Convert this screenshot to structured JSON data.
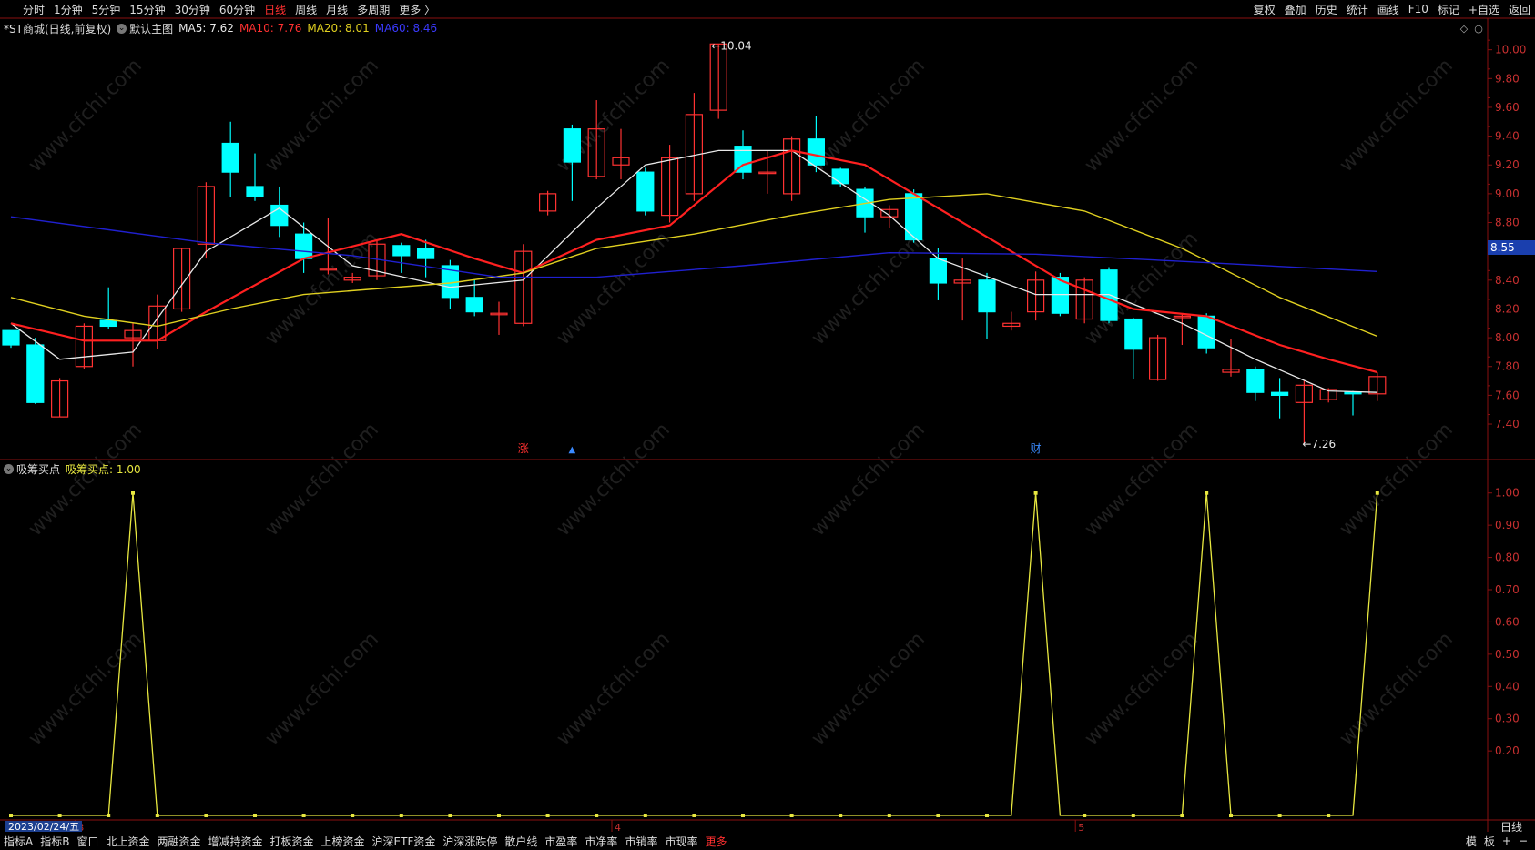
{
  "topbar": {
    "timeframes": [
      "分时",
      "1分钟",
      "5分钟",
      "15分钟",
      "30分钟",
      "60分钟",
      "日线",
      "周线",
      "月线",
      "多周期",
      "更多 〉"
    ],
    "active_index": 6,
    "tools": [
      "复权",
      "叠加",
      "历史",
      "统计",
      "画线",
      "F10",
      "标记",
      "+自选",
      "返回"
    ]
  },
  "main_header": {
    "stock": "*ST商城(日线,前复权)",
    "template": "默认主图",
    "ma5": "MA5: 7.62",
    "ma10": "MA10: 7.76",
    "ma20": "MA20: 8.01",
    "ma60": "MA60: 8.46"
  },
  "indicator_header": {
    "name": "吸筹买点",
    "value": "吸筹买点: 1.00"
  },
  "colors": {
    "up": "#ff3232",
    "down": "#00ffff",
    "ma5": "#e8e8e8",
    "ma10": "#ff2020",
    "ma20": "#e0d020",
    "ma60": "#2020d0",
    "indicator": "#e8e840",
    "axis": "#8a1010"
  },
  "chart_data": [
    {
      "type": "candlestick",
      "title": "*ST商城(日线,前复权)",
      "y_ticks": [
        10.0,
        9.8,
        9.6,
        9.4,
        9.2,
        9.0,
        8.8,
        8.6,
        8.4,
        8.2,
        8.0,
        7.8,
        7.6,
        7.4
      ],
      "ylim": [
        7.16,
        10.08
      ],
      "last_price": "8.55",
      "high_label": "10.04",
      "low_label": "7.26",
      "markers": [
        "涨",
        "▲",
        "财"
      ],
      "candles": [
        {
          "o": 8.05,
          "c": 7.95,
          "h": 8.05,
          "l": 7.93
        },
        {
          "o": 7.95,
          "c": 7.55,
          "h": 8.0,
          "l": 7.54
        },
        {
          "o": 7.45,
          "c": 7.7,
          "h": 7.72,
          "l": 7.45
        },
        {
          "o": 7.8,
          "c": 8.08,
          "h": 8.1,
          "l": 7.78
        },
        {
          "o": 8.12,
          "c": 8.08,
          "h": 8.35,
          "l": 8.06
        },
        {
          "o": 8.0,
          "c": 8.05,
          "h": 8.1,
          "l": 7.8
        },
        {
          "o": 7.98,
          "c": 8.22,
          "h": 8.3,
          "l": 7.92
        },
        {
          "o": 8.2,
          "c": 8.62,
          "h": 8.62,
          "l": 8.18
        },
        {
          "o": 8.65,
          "c": 9.05,
          "h": 9.08,
          "l": 8.55
        },
        {
          "o": 9.35,
          "c": 9.15,
          "h": 9.5,
          "l": 8.98
        },
        {
          "o": 9.05,
          "c": 8.98,
          "h": 9.28,
          "l": 8.95
        },
        {
          "o": 8.92,
          "c": 8.78,
          "h": 9.05,
          "l": 8.7
        },
        {
          "o": 8.72,
          "c": 8.55,
          "h": 8.8,
          "l": 8.45
        },
        {
          "o": 8.47,
          "c": 8.48,
          "h": 8.83,
          "l": 8.44
        },
        {
          "o": 8.4,
          "c": 8.42,
          "h": 8.45,
          "l": 8.38
        },
        {
          "o": 8.43,
          "c": 8.65,
          "h": 8.68,
          "l": 8.4
        },
        {
          "o": 8.64,
          "c": 8.57,
          "h": 8.66,
          "l": 8.45
        },
        {
          "o": 8.62,
          "c": 8.55,
          "h": 8.68,
          "l": 8.42
        },
        {
          "o": 8.5,
          "c": 8.28,
          "h": 8.54,
          "l": 8.2
        },
        {
          "o": 8.28,
          "c": 8.18,
          "h": 8.4,
          "l": 8.15
        },
        {
          "o": 8.16,
          "c": 8.17,
          "h": 8.25,
          "l": 8.02
        },
        {
          "o": 8.1,
          "c": 8.6,
          "h": 8.65,
          "l": 8.08
        },
        {
          "o": 8.88,
          "c": 9.0,
          "h": 9.02,
          "l": 8.85
        },
        {
          "o": 9.45,
          "c": 9.22,
          "h": 9.48,
          "l": 8.95
        },
        {
          "o": 9.12,
          "c": 9.45,
          "h": 9.65,
          "l": 9.1
        },
        {
          "o": 9.2,
          "c": 9.25,
          "h": 9.45,
          "l": 9.1
        },
        {
          "o": 9.15,
          "c": 8.88,
          "h": 9.18,
          "l": 8.85
        },
        {
          "o": 8.85,
          "c": 9.25,
          "h": 9.34,
          "l": 8.8
        },
        {
          "o": 9.0,
          "c": 9.55,
          "h": 9.7,
          "l": 8.95
        },
        {
          "o": 9.58,
          "c": 10.04,
          "h": 10.04,
          "l": 9.52
        },
        {
          "o": 9.33,
          "c": 9.15,
          "h": 9.44,
          "l": 9.1
        },
        {
          "o": 9.15,
          "c": 9.15,
          "h": 9.3,
          "l": 9.0
        },
        {
          "o": 9.0,
          "c": 9.38,
          "h": 9.4,
          "l": 8.95
        },
        {
          "o": 9.38,
          "c": 9.2,
          "h": 9.54,
          "l": 9.15
        },
        {
          "o": 9.17,
          "c": 9.07,
          "h": 9.18,
          "l": 9.05
        },
        {
          "o": 9.03,
          "c": 8.84,
          "h": 9.05,
          "l": 8.73
        },
        {
          "o": 8.84,
          "c": 8.89,
          "h": 8.92,
          "l": 8.76
        },
        {
          "o": 9.0,
          "c": 8.68,
          "h": 9.03,
          "l": 8.66
        },
        {
          "o": 8.55,
          "c": 8.38,
          "h": 8.62,
          "l": 8.26
        },
        {
          "o": 8.38,
          "c": 8.4,
          "h": 8.55,
          "l": 8.12
        },
        {
          "o": 8.4,
          "c": 8.18,
          "h": 8.45,
          "l": 7.99
        },
        {
          "o": 8.08,
          "c": 8.1,
          "h": 8.18,
          "l": 8.05
        },
        {
          "o": 8.18,
          "c": 8.4,
          "h": 8.46,
          "l": 8.12
        },
        {
          "o": 8.42,
          "c": 8.17,
          "h": 8.45,
          "l": 8.15
        },
        {
          "o": 8.13,
          "c": 8.4,
          "h": 8.42,
          "l": 8.1
        },
        {
          "o": 8.47,
          "c": 8.12,
          "h": 8.49,
          "l": 8.1
        },
        {
          "o": 8.13,
          "c": 7.92,
          "h": 8.14,
          "l": 7.71
        },
        {
          "o": 7.71,
          "c": 8.0,
          "h": 8.02,
          "l": 7.7
        },
        {
          "o": 8.14,
          "c": 8.15,
          "h": 8.17,
          "l": 7.95
        },
        {
          "o": 8.15,
          "c": 7.93,
          "h": 8.17,
          "l": 7.89
        },
        {
          "o": 7.76,
          "c": 7.78,
          "h": 7.99,
          "l": 7.73
        },
        {
          "o": 7.78,
          "c": 7.62,
          "h": 7.8,
          "l": 7.56
        },
        {
          "o": 7.62,
          "c": 7.6,
          "h": 7.72,
          "l": 7.44
        },
        {
          "o": 7.55,
          "c": 7.67,
          "h": 7.7,
          "l": 7.26
        },
        {
          "o": 7.57,
          "c": 7.64,
          "h": 7.65,
          "l": 7.55
        },
        {
          "o": 7.62,
          "c": 7.61,
          "h": 7.63,
          "l": 7.46
        },
        {
          "o": 7.61,
          "c": 7.73,
          "h": 7.76,
          "l": 7.56
        }
      ],
      "ma_series": [
        {
          "name": "MA5",
          "points": [
            [
              0,
              8.1
            ],
            [
              2,
              7.85
            ],
            [
              5,
              7.9
            ],
            [
              8,
              8.6
            ],
            [
              11,
              8.9
            ],
            [
              14,
              8.5
            ],
            [
              18,
              8.35
            ],
            [
              21,
              8.4
            ],
            [
              24,
              8.9
            ],
            [
              26,
              9.2
            ],
            [
              29,
              9.3
            ],
            [
              32,
              9.3
            ],
            [
              36,
              8.85
            ],
            [
              38,
              8.55
            ],
            [
              42,
              8.3
            ],
            [
              45,
              8.3
            ],
            [
              48,
              8.1
            ],
            [
              51,
              7.85
            ],
            [
              54,
              7.63
            ],
            [
              56,
              7.62
            ]
          ]
        },
        {
          "name": "MA10",
          "points": [
            [
              0,
              8.1
            ],
            [
              3,
              7.98
            ],
            [
              6,
              7.98
            ],
            [
              8,
              8.18
            ],
            [
              12,
              8.55
            ],
            [
              16,
              8.72
            ],
            [
              19,
              8.55
            ],
            [
              21,
              8.45
            ],
            [
              24,
              8.68
            ],
            [
              27,
              8.78
            ],
            [
              30,
              9.2
            ],
            [
              32,
              9.3
            ],
            [
              35,
              9.2
            ],
            [
              37,
              9.0
            ],
            [
              40,
              8.7
            ],
            [
              43,
              8.4
            ],
            [
              46,
              8.2
            ],
            [
              49,
              8.15
            ],
            [
              52,
              7.95
            ],
            [
              54,
              7.85
            ],
            [
              56,
              7.76
            ]
          ]
        },
        {
          "name": "MA20",
          "points": [
            [
              0,
              8.28
            ],
            [
              3,
              8.15
            ],
            [
              6,
              8.08
            ],
            [
              9,
              8.2
            ],
            [
              12,
              8.3
            ],
            [
              18,
              8.38
            ],
            [
              21,
              8.45
            ],
            [
              24,
              8.62
            ],
            [
              28,
              8.72
            ],
            [
              32,
              8.85
            ],
            [
              36,
              8.96
            ],
            [
              40,
              9.0
            ],
            [
              44,
              8.88
            ],
            [
              48,
              8.62
            ],
            [
              52,
              8.28
            ],
            [
              56,
              8.01
            ]
          ]
        },
        {
          "name": "MA60",
          "points": [
            [
              0,
              8.84
            ],
            [
              8,
              8.66
            ],
            [
              14,
              8.57
            ],
            [
              20,
              8.42
            ],
            [
              24,
              8.42
            ],
            [
              30,
              8.5
            ],
            [
              36,
              8.59
            ],
            [
              42,
              8.58
            ],
            [
              48,
              8.53
            ],
            [
              56,
              8.46
            ]
          ]
        }
      ]
    },
    {
      "type": "line",
      "title": "吸筹买点",
      "y_ticks": [
        1.0,
        0.9,
        0.8,
        0.7,
        0.6,
        0.5,
        0.4,
        0.3,
        0.2
      ],
      "ylim": [
        0,
        1.05
      ],
      "values": [
        0,
        0,
        0,
        0,
        0,
        1,
        0,
        0,
        0,
        0,
        0,
        0,
        0,
        0,
        0,
        0,
        0,
        0,
        0,
        0,
        0,
        0,
        0,
        0,
        0,
        0,
        0,
        0,
        0,
        0,
        0,
        0,
        0,
        0,
        0,
        0,
        0,
        0,
        0,
        0,
        0,
        0,
        1,
        0,
        0,
        0,
        0,
        0,
        0,
        1,
        0,
        0,
        0,
        0,
        0,
        0,
        1
      ]
    }
  ],
  "axis_dates": {
    "start_date": "2023/02/24/五",
    "month_marks": [
      "3",
      "4",
      "5"
    ],
    "period": "日线"
  },
  "bottombar": {
    "tabs": [
      "指标A",
      "指标B",
      "窗口",
      "北上资金",
      "两融资金",
      "增减持资金",
      "打板资金",
      "上榜资金",
      "沪深ETF资金",
      "沪深涨跌停",
      "散户线",
      "市盈率",
      "市净率",
      "市销率",
      "市现率",
      "更多"
    ],
    "active_index": 15,
    "right": [
      "模",
      "板",
      "+",
      "−"
    ]
  },
  "watermark": "www.cfchi.com"
}
